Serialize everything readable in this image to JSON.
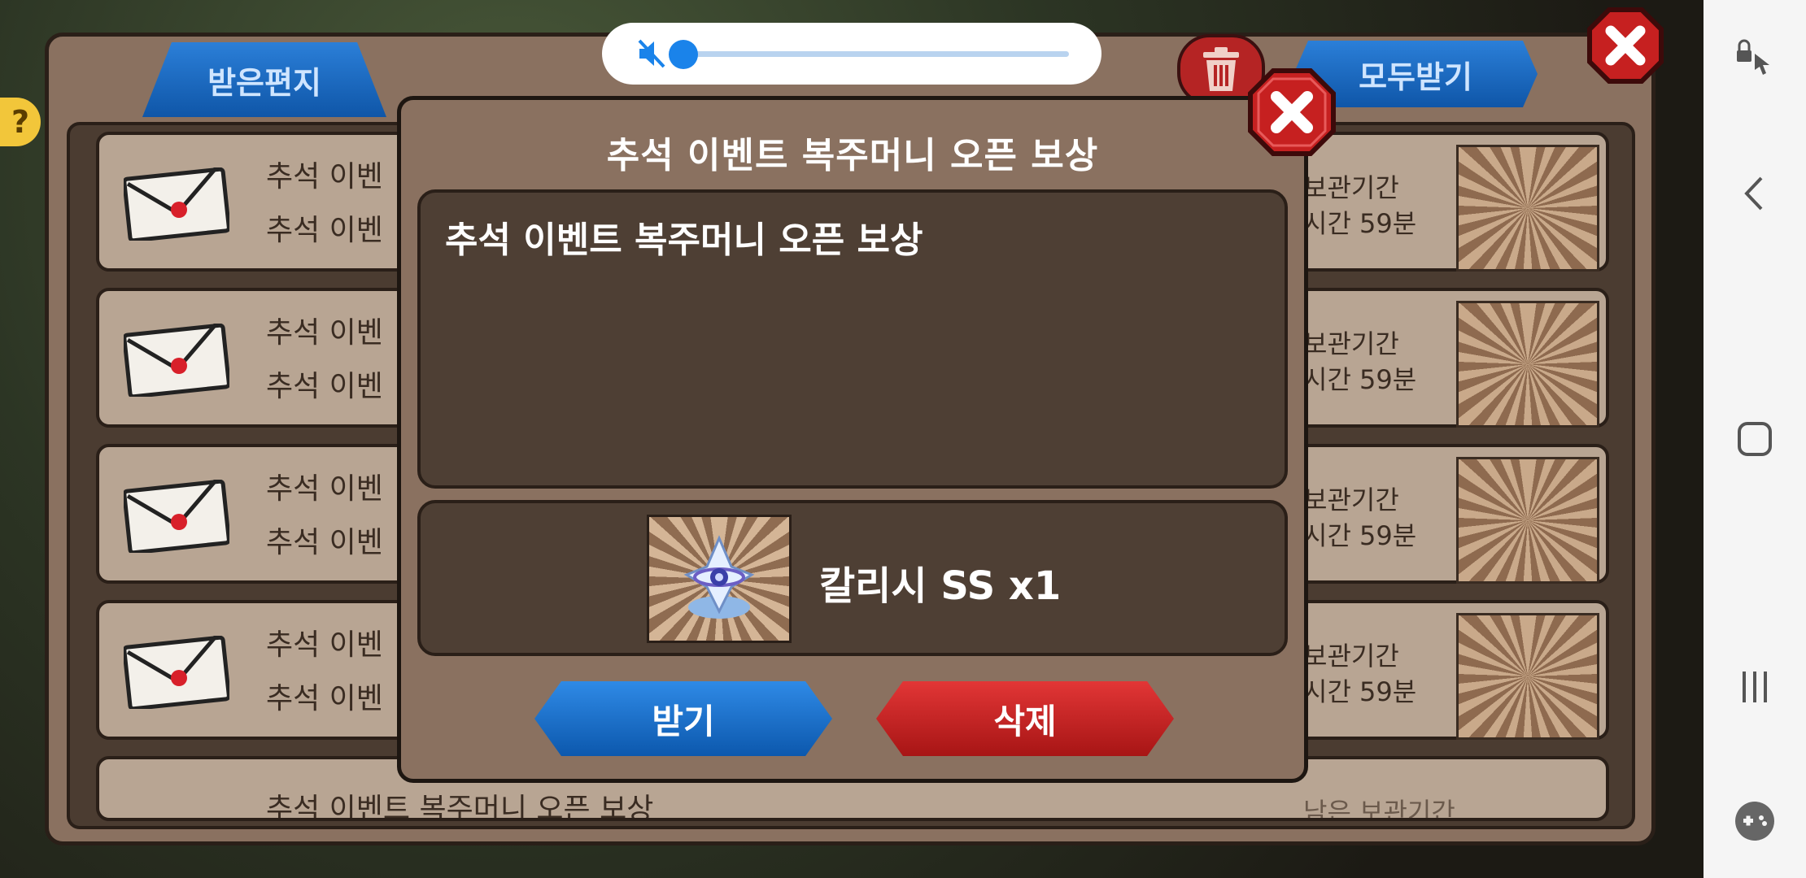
{
  "mailbox": {
    "tab_inbox": "받은편지",
    "receive_all": "모두받기",
    "help_label": "?",
    "rows": [
      {
        "line1": "추석 이벤",
        "line2": "추석 이벤",
        "keep_label": "보관기간",
        "keep_time": "시간 59분",
        "item": "calyx-ss"
      },
      {
        "line1": "추석 이벤",
        "line2": "추석 이벤",
        "keep_label": "보관기간",
        "keep_time": "시간 59분",
        "item": "blue-gem"
      },
      {
        "line1": "추석 이벤",
        "line2": "추석 이벤",
        "keep_label": "보관기간",
        "keep_time": "시간 59분",
        "item": "yellow-potion"
      },
      {
        "line1": "추석 이벤",
        "line2": "추석 이벤",
        "keep_label": "보관기간",
        "keep_time": "시간 59분",
        "item": "r-stone"
      },
      {
        "line1": "추석 이벤트 복주머니 오픈 보상",
        "line2": "",
        "keep_label": "남은 보관기간",
        "keep_time": "",
        "item": "grey-item"
      }
    ]
  },
  "dialog": {
    "title": "추석 이벤트 복주머니 오픈 보상",
    "message": "추석 이벤트 복주머니 오픈 보상",
    "reward_text": "칼리시 SS x1",
    "receive_button": "받기",
    "delete_button": "삭제"
  },
  "volume": {
    "muted": true,
    "level_percent": 0
  },
  "colors": {
    "blue_button": "#1566c4",
    "red_button": "#c81f1f",
    "panel": "#8a7160",
    "panel_dark": "#4e3f34",
    "volume_accent": "#1a83ea"
  },
  "navbar": {
    "icons": [
      "lock-touch-icon",
      "back-icon",
      "home-icon",
      "recents-icon",
      "game-tools-icon"
    ]
  }
}
